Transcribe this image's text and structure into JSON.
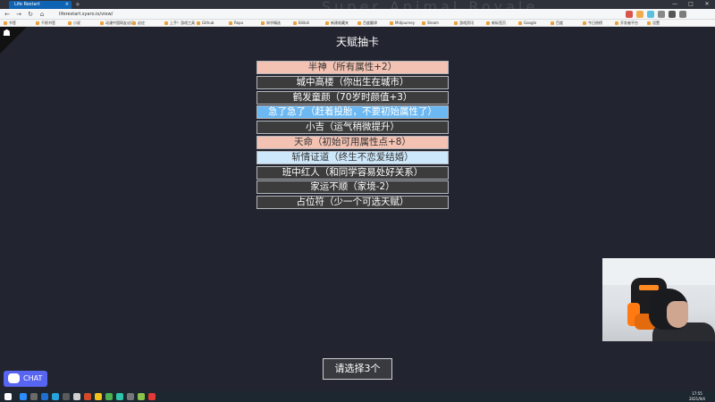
{
  "browser": {
    "tab_title": "Life Restart",
    "tab_close": "×",
    "new_tab": "+",
    "stream_title": "Super Animal Royale",
    "url": "liferestart.syaro.io/view/",
    "nav": {
      "back": "←",
      "forward": "→",
      "reload": "↻",
      "home": "⌂"
    },
    "window": {
      "minimize": "—",
      "maximize": "□",
      "close": "✕"
    },
    "bookmarks": [
      "书签",
      "千帆书签",
      "小说",
      "动漫中国网友论坛",
      "必应",
      "上手！游戏工具",
      "Github",
      "Repo",
      "知乎精选",
      "Bilibili",
      "新建收藏夹",
      "百度翻译",
      "Midjourney",
      "Steam",
      "游戏资讯",
      "新标签页",
      "Google",
      "百度",
      "今日热榜",
      "开发者平台",
      "设置"
    ]
  },
  "page": {
    "corner_icon": "☗",
    "title": "天赋抽卡",
    "talents": [
      {
        "label": "半神（所有属性+2）",
        "style": "orange"
      },
      {
        "label": "城中高楼（你出生在城市）",
        "style": "grey"
      },
      {
        "label": "鹤发童颜（70岁时颜值+3）",
        "style": "grey"
      },
      {
        "label": "急了急了（赶着投胎，不要初始属性了）",
        "style": "blue"
      },
      {
        "label": "小吉（运气稍微提升）",
        "style": "grey"
      },
      {
        "label": "天命（初始可用属性点+8）",
        "style": "orange"
      },
      {
        "label": "斩情证道（终生不恋爱结婚）",
        "style": "lightblue"
      },
      {
        "label": "班中红人（和同学容易处好关系）",
        "style": "grey"
      },
      {
        "label": "家运不顺（家境-2）",
        "style": "grey"
      },
      {
        "label": "占位符（少一个可选天赋）",
        "style": "grey"
      }
    ],
    "confirm_label": "请选择3个",
    "chat_label": "CHAT"
  },
  "taskbar": {
    "time": "17:55",
    "date": "2021/9/4",
    "icon_colors": [
      "#2d8cff",
      "#6a6a6a",
      "#1f6fd1",
      "#27a2db",
      "#5a5a5a",
      "#cfcfcf",
      "#d24a2a",
      "#f2c21b",
      "#4caf50",
      "#2ec4a8",
      "#777777",
      "#8bc34a",
      "#e53935"
    ]
  },
  "colors": {
    "page_bg": "#22252f",
    "talent_grey": "#3c3c3c",
    "talent_orange": "#f3c2b2",
    "talent_blue": "#6cb8f2",
    "talent_lightblue": "#cde8fb",
    "discord": "#5865f2"
  }
}
